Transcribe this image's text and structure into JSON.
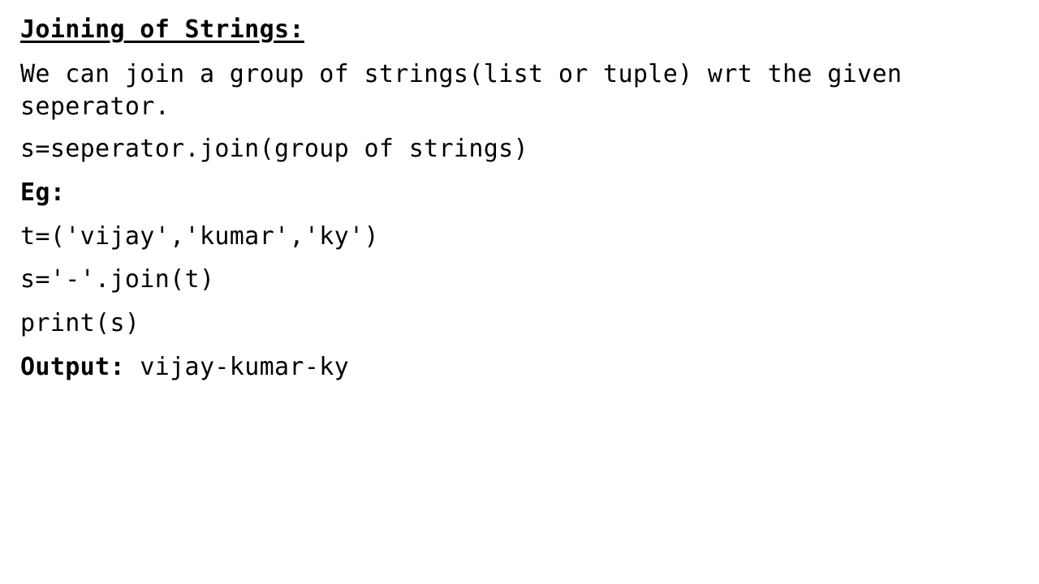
{
  "title": "Joining of Strings:",
  "description": "We can join a group of strings(list or tuple) wrt the given seperator.",
  "syntax": "s=seperator.join(group of strings)",
  "example_label": "Eg:",
  "code_lines": [
    "t=('vijay','kumar','ky')",
    "s='-'.join(t)",
    "print(s)"
  ],
  "output": {
    "label": "Output:",
    "value": "vijay-kumar-ky"
  }
}
